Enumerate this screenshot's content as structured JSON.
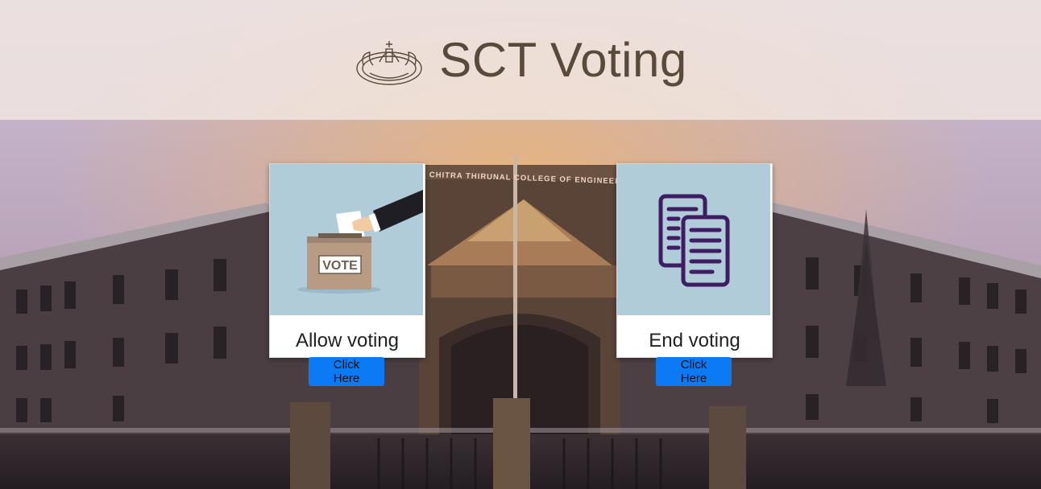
{
  "header": {
    "title": "SCT Voting",
    "emblem_icon": "kerala-state-emblem-icon"
  },
  "background": {
    "building_sign": "SREE CHITRA THIRUNAL COLLEGE OF ENGINEERING"
  },
  "cards": [
    {
      "id": "allow",
      "label": "Allow voting",
      "icon": "ballot-box-vote-icon",
      "box_text": "VOTE",
      "button_label": "Click Here"
    },
    {
      "id": "end",
      "label": "End voting",
      "icon": "documents-icon",
      "button_label": "Click Here"
    }
  ],
  "colors": {
    "header_bg": "#f3e8e2",
    "title": "#5a4a3c",
    "button": "#0d7af5",
    "card_image_bg": "#b0ccd8",
    "document_icon": "#3f1d63"
  }
}
